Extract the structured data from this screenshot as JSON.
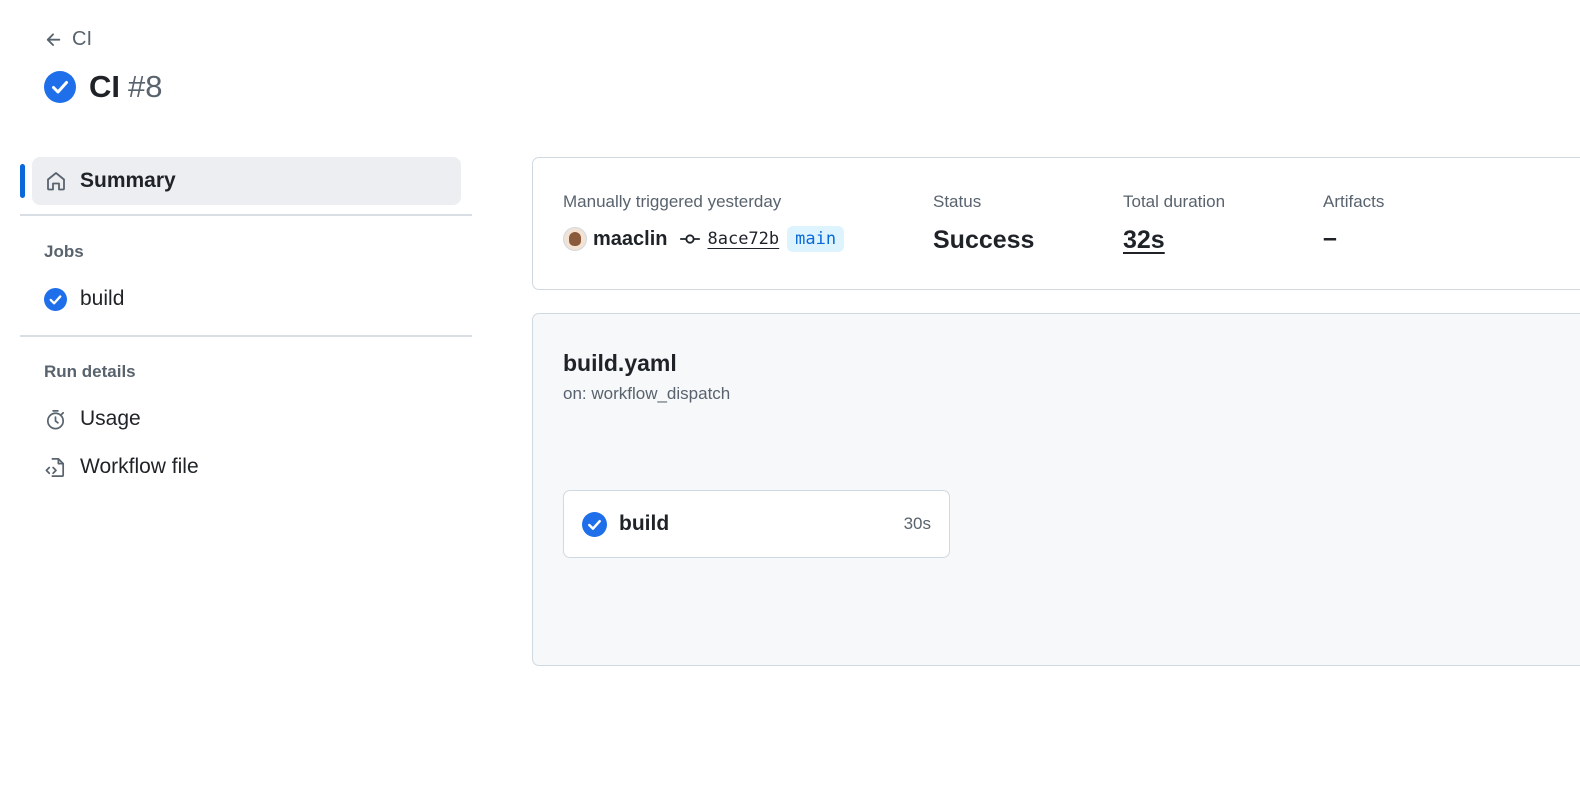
{
  "header": {
    "back_label": "CI",
    "title": "CI",
    "run_number": "#8"
  },
  "sidebar": {
    "summary_label": "Summary",
    "jobs_heading": "Jobs",
    "jobs": [
      {
        "label": "build",
        "status": "success"
      }
    ],
    "run_details_heading": "Run details",
    "details": [
      {
        "label": "Usage",
        "icon": "stopwatch-icon"
      },
      {
        "label": "Workflow file",
        "icon": "file-code-icon"
      }
    ]
  },
  "summary": {
    "trigger_label": "Manually triggered yesterday",
    "actor": "maaclin",
    "commit_sha": "8ace72b",
    "branch": "main",
    "status_label": "Status",
    "status_value": "Success",
    "duration_label": "Total duration",
    "duration_value": "32s",
    "artifacts_label": "Artifacts",
    "artifacts_value": "–"
  },
  "graph": {
    "workflow_file": "build.yaml",
    "trigger": "on: workflow_dispatch",
    "job": {
      "name": "build",
      "duration": "30s"
    }
  },
  "colors": {
    "success": "#1f6feb",
    "accent": "#0969da",
    "muted": "#59636e"
  }
}
